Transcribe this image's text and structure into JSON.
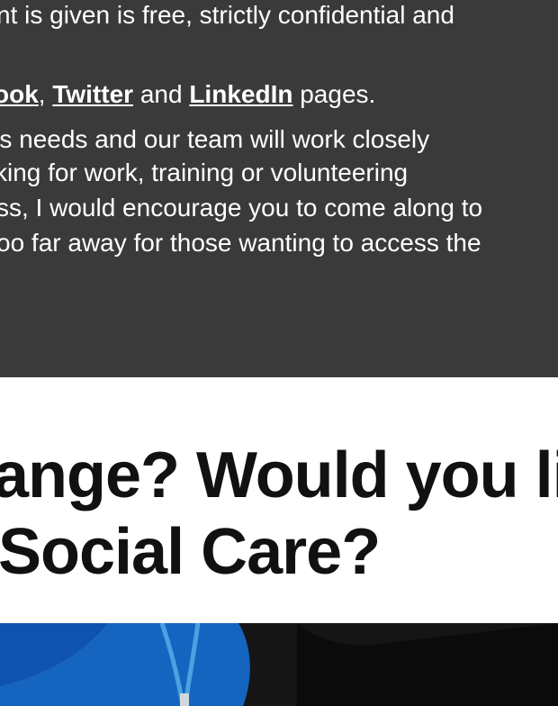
{
  "intro": {
    "line1": "nt is given is free, strictly confidential and",
    "social_prefix": "ook",
    "social_sep": ",",
    "social_twitter": "Twitter",
    "social_and": "and",
    "social_linkedin": "LinkedIn",
    "social_suffix": "pages.",
    "line3": "'s needs and our team will work closely",
    "line4": "king for work, training or volunteering",
    "line5": "ss, I would encourage you to come along to",
    "line6": "oo far away for those wanting to access the"
  },
  "heading": {
    "line1": "ange? Would you like",
    "line2": "Social Care?"
  },
  "photo": {
    "colors": {
      "scrubs": "#1565c0",
      "lanyard": "#4aa3e0",
      "dark": "#151515"
    }
  }
}
